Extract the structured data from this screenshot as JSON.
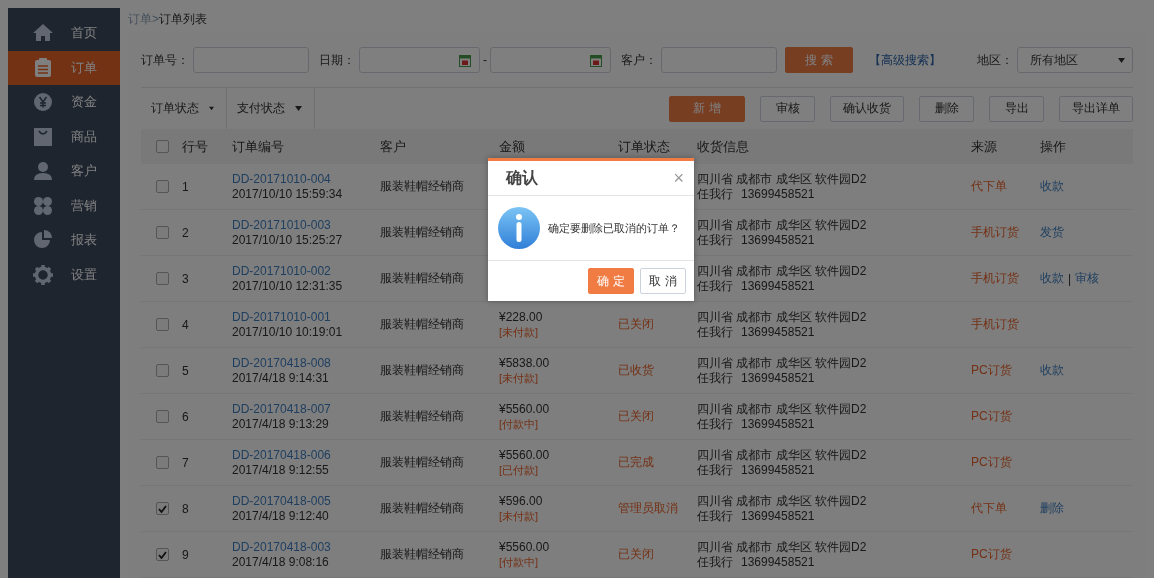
{
  "sidebar": {
    "items": [
      {
        "label": "首页",
        "selected": false
      },
      {
        "label": "订单",
        "selected": true
      },
      {
        "label": "资金",
        "selected": false
      },
      {
        "label": "商品",
        "selected": false
      },
      {
        "label": "客户",
        "selected": false
      },
      {
        "label": "营销",
        "selected": false
      },
      {
        "label": "报表",
        "selected": false
      },
      {
        "label": "设置",
        "selected": false
      }
    ]
  },
  "breadcrumb": {
    "parent": "订单",
    "separator": ">",
    "current": "订单列表"
  },
  "filters": {
    "order_no": {
      "label": "订单号："
    },
    "date": {
      "label": "日期：",
      "separator": "-"
    },
    "customer": {
      "label": "客户："
    },
    "search_button": "搜 索",
    "advanced_search": "【高级搜索】",
    "region": {
      "label": "地区：",
      "value": "所有地区"
    }
  },
  "toolbar": {
    "dropdowns": [
      {
        "label": "订单状态"
      },
      {
        "label": "支付状态"
      }
    ],
    "buttons": [
      {
        "label": "新 增",
        "primary": true
      },
      {
        "label": "审核",
        "primary": false
      },
      {
        "label": "确认收货",
        "primary": false
      },
      {
        "label": "删除",
        "primary": false
      },
      {
        "label": "导出",
        "primary": false
      },
      {
        "label": "导出详单",
        "primary": false
      }
    ]
  },
  "table": {
    "select_all": {
      "checked": false
    },
    "columns": [
      "行号",
      "订单编号",
      "客户",
      "金额",
      "订单状态",
      "收货信息",
      "来源",
      "操作"
    ],
    "action_separator": "|",
    "rows": [
      {
        "checked": false,
        "index": "1",
        "order_no": "DD-20171010-004",
        "time": "2017/10/10 15:59:34",
        "customer": "服装鞋帽经销商",
        "address": "四川省 成都市 成华区 软件园D2",
        "contact_name": "任我行",
        "phone": "13699458521",
        "source": "代下单",
        "actions": [
          "收款"
        ]
      },
      {
        "checked": false,
        "index": "2",
        "order_no": "DD-20171010-003",
        "time": "2017/10/10 15:25:27",
        "customer": "服装鞋帽经销商",
        "address": "四川省 成都市 成华区 软件园D2",
        "contact_name": "任我行",
        "phone": "13699458521",
        "source": "手机订货",
        "actions": [
          "发货"
        ]
      },
      {
        "checked": false,
        "index": "3",
        "order_no": "DD-20171010-002",
        "time": "2017/10/10 12:31:35",
        "customer": "服装鞋帽经销商",
        "address": "四川省 成都市 成华区 软件园D2",
        "contact_name": "任我行",
        "phone": "13699458521",
        "source": "手机订货",
        "actions": [
          "收款",
          "审核"
        ]
      },
      {
        "checked": false,
        "index": "4",
        "order_no": "DD-20171010-001",
        "time": "2017/10/10 10:19:01",
        "customer": "服装鞋帽经销商",
        "amount": "¥228.00",
        "payment": "[未付款]",
        "status": "已关闭",
        "address": "四川省 成都市 成华区 软件园D2",
        "contact_name": "任我行",
        "phone": "13699458521",
        "source": "手机订货",
        "actions": []
      },
      {
        "checked": false,
        "index": "5",
        "order_no": "DD-20170418-008",
        "time": "2017/4/18 9:14:31",
        "customer": "服装鞋帽经销商",
        "amount": "¥5838.00",
        "payment": "[未付款]",
        "status": "已收货",
        "address": "四川省 成都市 成华区 软件园D2",
        "contact_name": "任我行",
        "phone": "13699458521",
        "source": "PC订货",
        "actions": [
          "收款"
        ]
      },
      {
        "checked": false,
        "index": "6",
        "order_no": "DD-20170418-007",
        "time": "2017/4/18 9:13:29",
        "customer": "服装鞋帽经销商",
        "amount": "¥5560.00",
        "payment": "[付款中]",
        "status": "已关闭",
        "address": "四川省 成都市 成华区 软件园D2",
        "contact_name": "任我行",
        "phone": "13699458521",
        "source": "PC订货",
        "actions": []
      },
      {
        "checked": false,
        "index": "7",
        "order_no": "DD-20170418-006",
        "time": "2017/4/18 9:12:55",
        "customer": "服装鞋帽经销商",
        "amount": "¥5560.00",
        "payment": "[已付款]",
        "status": "已完成",
        "address": "四川省 成都市 成华区 软件园D2",
        "contact_name": "任我行",
        "phone": "13699458521",
        "source": "PC订货",
        "actions": []
      },
      {
        "checked": true,
        "index": "8",
        "order_no": "DD-20170418-005",
        "time": "2017/4/18 9:12:40",
        "customer": "服装鞋帽经销商",
        "amount": "¥596.00",
        "payment": "[未付款]",
        "status": "管理员取消",
        "address": "四川省 成都市 成华区 软件园D2",
        "contact_name": "任我行",
        "phone": "13699458521",
        "source": "代下单",
        "actions": [
          "删除"
        ]
      },
      {
        "checked": true,
        "index": "9",
        "order_no": "DD-20170418-003",
        "time": "2017/4/18 9:08:16",
        "customer": "服装鞋帽经销商",
        "amount": "¥5560.00",
        "payment": "[付款中]",
        "status": "已关闭",
        "address": "四川省 成都市 成华区 软件园D2",
        "contact_name": "任我行",
        "phone": "13699458521",
        "source": "PC订货",
        "actions": []
      }
    ]
  },
  "modal": {
    "title": "确认",
    "close": "×",
    "message": "确定要删除已取消的订单？",
    "buttons": [
      {
        "label": "确 定",
        "primary": true
      },
      {
        "label": "取 消",
        "primary": false
      }
    ]
  }
}
